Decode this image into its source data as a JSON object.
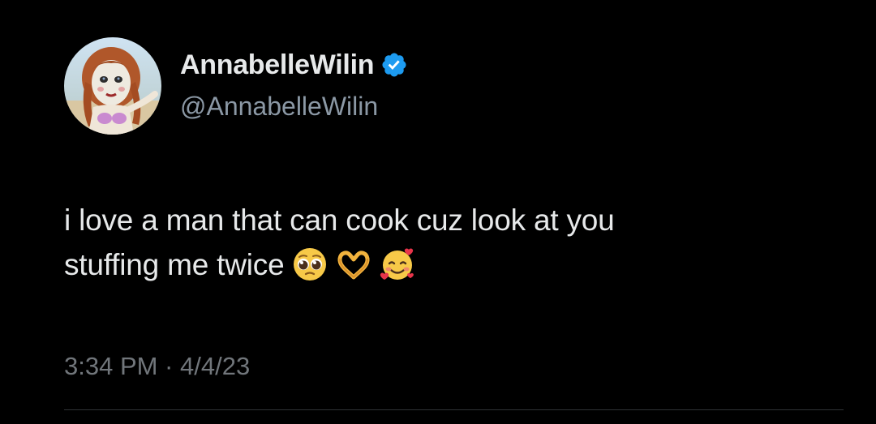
{
  "tweet": {
    "author": {
      "display_name": "AnnabelleWilin",
      "handle": "@AnnabelleWilin",
      "verified_icon": "verified-badge-icon",
      "avatar": "annabelle-doll-avatar"
    },
    "text_line_1": "i love a man that can cook cuz look at you",
    "text_line_2": "stuffing me twice",
    "emojis": [
      "pleading-face-emoji",
      "heart-hands-emoji",
      "smiling-face-with-hearts-emoji"
    ],
    "timestamp": "3:34 PM · 4/4/23"
  },
  "colors": {
    "background": "#000000",
    "primary_text": "#e7e9ea",
    "secondary_text": "#8b98a5",
    "verified_blue": "#1d9bf0",
    "divider": "#2f3336"
  }
}
